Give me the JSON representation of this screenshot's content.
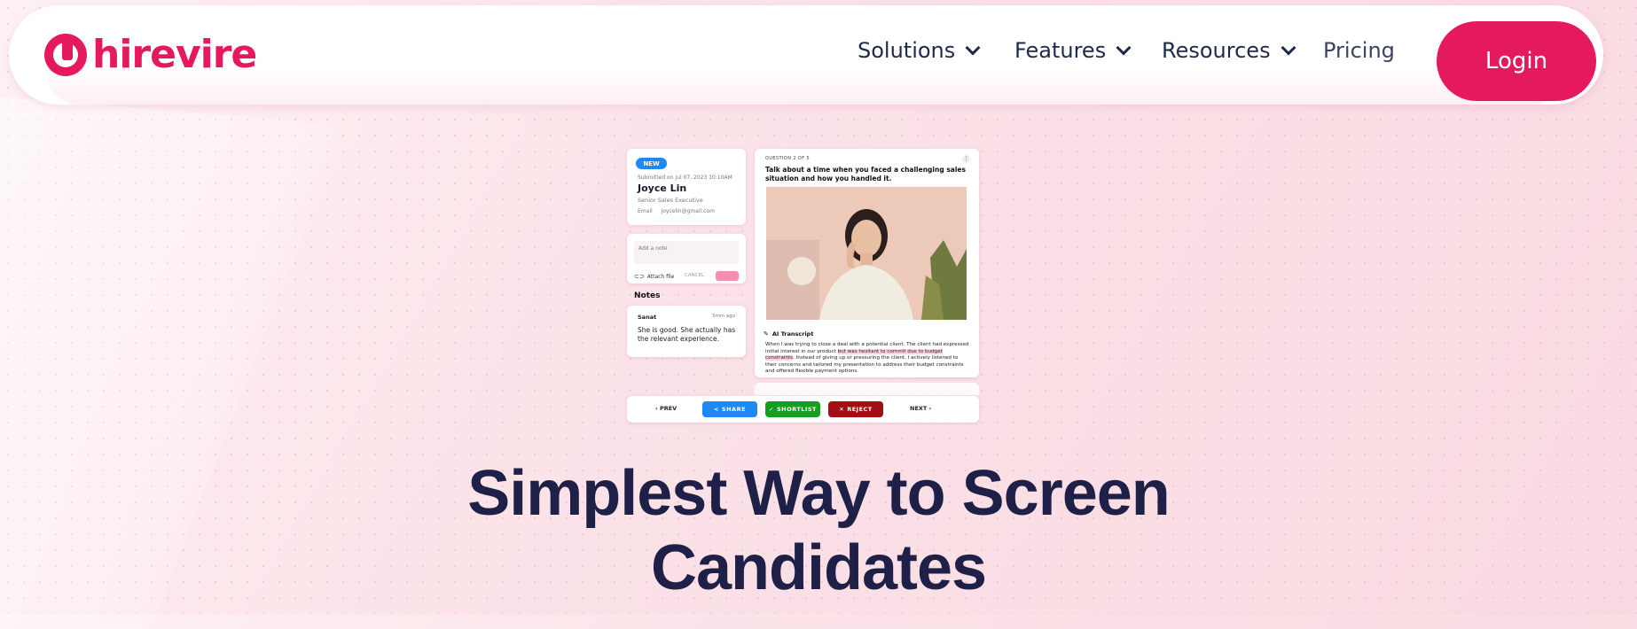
{
  "brand": {
    "name": "hirevire",
    "color": "#e5195e"
  },
  "nav": {
    "items": [
      {
        "label": "Solutions",
        "has_dropdown": true
      },
      {
        "label": "Features",
        "has_dropdown": true
      },
      {
        "label": "Resources",
        "has_dropdown": true
      },
      {
        "label": "Pricing",
        "has_dropdown": false
      }
    ],
    "login_label": "Login"
  },
  "mockup": {
    "candidate": {
      "badge": "NEW",
      "submitted": "Submitted on Jul 07, 2023 10:10AM",
      "name": "Joyce Lin",
      "role": "Senior Sales Executive",
      "email_label": "Email",
      "email": "joycelin@gmail.com"
    },
    "note_input": {
      "placeholder": "Add a note",
      "attach_label": "Attach file",
      "cancel_label": "CANCEL"
    },
    "notes": {
      "title": "Notes",
      "author": "Sanat",
      "time": "5min ago",
      "text": "She is good. She actually has the relevant experience."
    },
    "question": {
      "counter": "QUESTION 2 OF 5",
      "text": "Talk about a time when you faced a challenging sales situation and how you handled it."
    },
    "transcript": {
      "title": "AI Transcript",
      "text_before": "When I was trying to close a deal with a potential client. The client had expressed initial interest in our product ",
      "highlight": "but was hesitant to commit due to budget constraints",
      "text_after": ". Instead of giving up or pressuring the client, I actively listened to their concerns and tailored my presentation to address their budget constraints and offered flexible payment options."
    },
    "actions": {
      "prev": "PREV",
      "share": "SHARE",
      "shortlist": "SHORTLIST",
      "reject": "REJECT",
      "next": "NEXT"
    }
  },
  "hero": {
    "line1": "Simplest Way to Screen",
    "line2": "Candidates"
  }
}
